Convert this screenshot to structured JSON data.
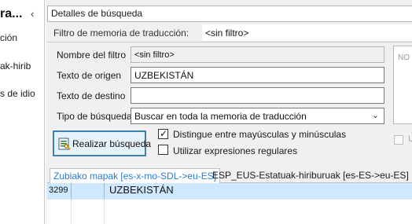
{
  "left_panel": {
    "title": "ra...",
    "items": [
      "ción",
      "ak-hirib",
      "s de idio"
    ]
  },
  "search_details": {
    "header": "Detalles de búsqueda",
    "filter_label": "Filtro de memoria de traducción:",
    "filter_value": "<sin filtro>",
    "fields": {
      "filter_name_label": "Nombre del filtro",
      "filter_name_value": "<sin filtro>",
      "source_label": "Texto de origen",
      "source_value": "UZBEKISTÁN",
      "target_label": "Texto de destino",
      "target_value": "",
      "search_type_label": "Tipo de búsqueda",
      "search_type_value": "Buscar en toda la memoria de traducción"
    },
    "search_button": "Realizar búsqueda",
    "case_sensitive_label": "Distingue entre mayúsculas y minúsculas",
    "case_sensitive_checked": true,
    "regex_label": "Utilizar expresiones regulares",
    "regex_checked": false,
    "right_box_text": "NO",
    "right_check_label": "U"
  },
  "tabs": [
    {
      "label": "Zubiako mapak [es-x-mo-SDL->eu-ES]",
      "active": true
    },
    {
      "label": "ESP_EUS-Estatuak-hiriburuak [es-ES->eu-ES]",
      "active": false
    }
  ],
  "results": [
    {
      "id": "3299",
      "text": "UZBEKISTÁN"
    }
  ],
  "colors": {
    "accent": "#2a7bd4",
    "selected_row": "#cde8ff",
    "button_border": "#3c7fb1"
  },
  "icons": {
    "collapse": "chevron-left-icon",
    "dropdown": "chevron-down-icon",
    "search_button": "search-results-icon"
  }
}
